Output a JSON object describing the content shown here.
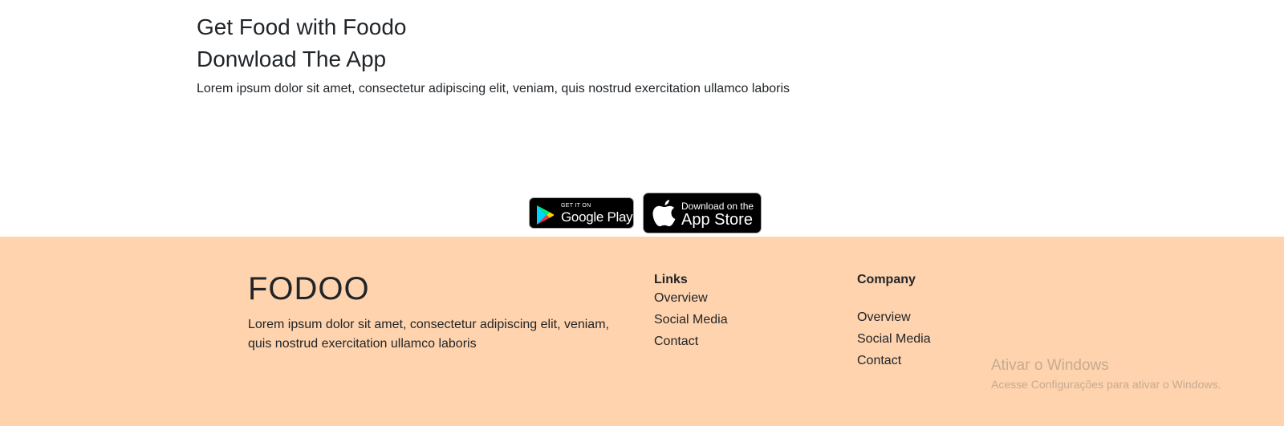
{
  "download": {
    "title_line1": "Get Food with Foodo",
    "title_line2": "Donwload The App",
    "description": "Lorem ipsum dolor sit amet, consectetur adipiscing elit, veniam, quis nostrud exercitation ullamco laboris"
  },
  "badges": {
    "google_small": "GET IT ON",
    "google_big": "Google Play",
    "apple_small": "Download on the",
    "apple_big": "App Store"
  },
  "footer": {
    "brand": "FODOO",
    "brand_description": "Lorem ipsum dolor sit amet, consectetur adipiscing elit, veniam, quis nostrud exercitation ullamco laboris",
    "links_title": "Links",
    "links": [
      "Overview",
      "Social Media",
      "Contact"
    ],
    "company_title": "Company",
    "company_links": [
      "Overview",
      "Social Media",
      "Contact"
    ],
    "background_color": "#fed3ad"
  },
  "watermark": {
    "line1": "Ativar o Windows",
    "line2": "Acesse Configurações para ativar o Windows."
  }
}
